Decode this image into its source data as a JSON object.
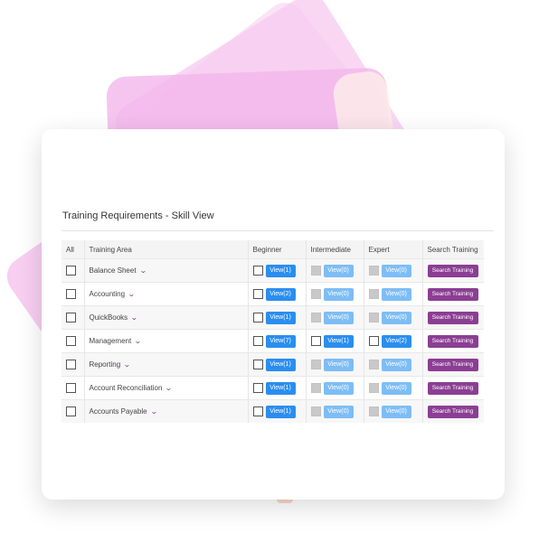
{
  "title": "Training Requirements - Skill View",
  "headers": {
    "all": "All",
    "area": "Training Area",
    "beginner": "Beginner",
    "intermediate": "Intermediate",
    "expert": "Expert",
    "search": "Search Training"
  },
  "rows": [
    {
      "area": "Balance Sheet",
      "beginner": "View(1)",
      "intermediate": "View(0)",
      "expert": "View(0)",
      "search": "Search Training"
    },
    {
      "area": "Accounting",
      "beginner": "View(2)",
      "intermediate": "View(0)",
      "expert": "View(0)",
      "search": "Search Training"
    },
    {
      "area": "QuickBooks",
      "beginner": "View(1)",
      "intermediate": "View(0)",
      "expert": "View(0)",
      "search": "Search Training"
    },
    {
      "area": "Management",
      "beginner": "View(7)",
      "intermediate": "View(1)",
      "expert": "View(2)",
      "search": "Search Training"
    },
    {
      "area": "Reporting",
      "beginner": "View(1)",
      "intermediate": "View(0)",
      "expert": "View(0)",
      "search": "Search Training"
    },
    {
      "area": "Account Reconciliation",
      "beginner": "View(1)",
      "intermediate": "View(0)",
      "expert": "View(0)",
      "search": "Search Training"
    },
    {
      "area": "Accounts Payable",
      "beginner": "View(1)",
      "intermediate": "View(0)",
      "expert": "View(0)",
      "search": "Search Training"
    }
  ],
  "icons": {
    "expand": "chevron-down-icon",
    "checkbox": "checkbox-icon"
  },
  "colors": {
    "view_button": "#2a8ef0",
    "view_button_disabled": "#7dbdf5",
    "search_button": "#8b3e93",
    "chevron": "#8b3e93"
  }
}
